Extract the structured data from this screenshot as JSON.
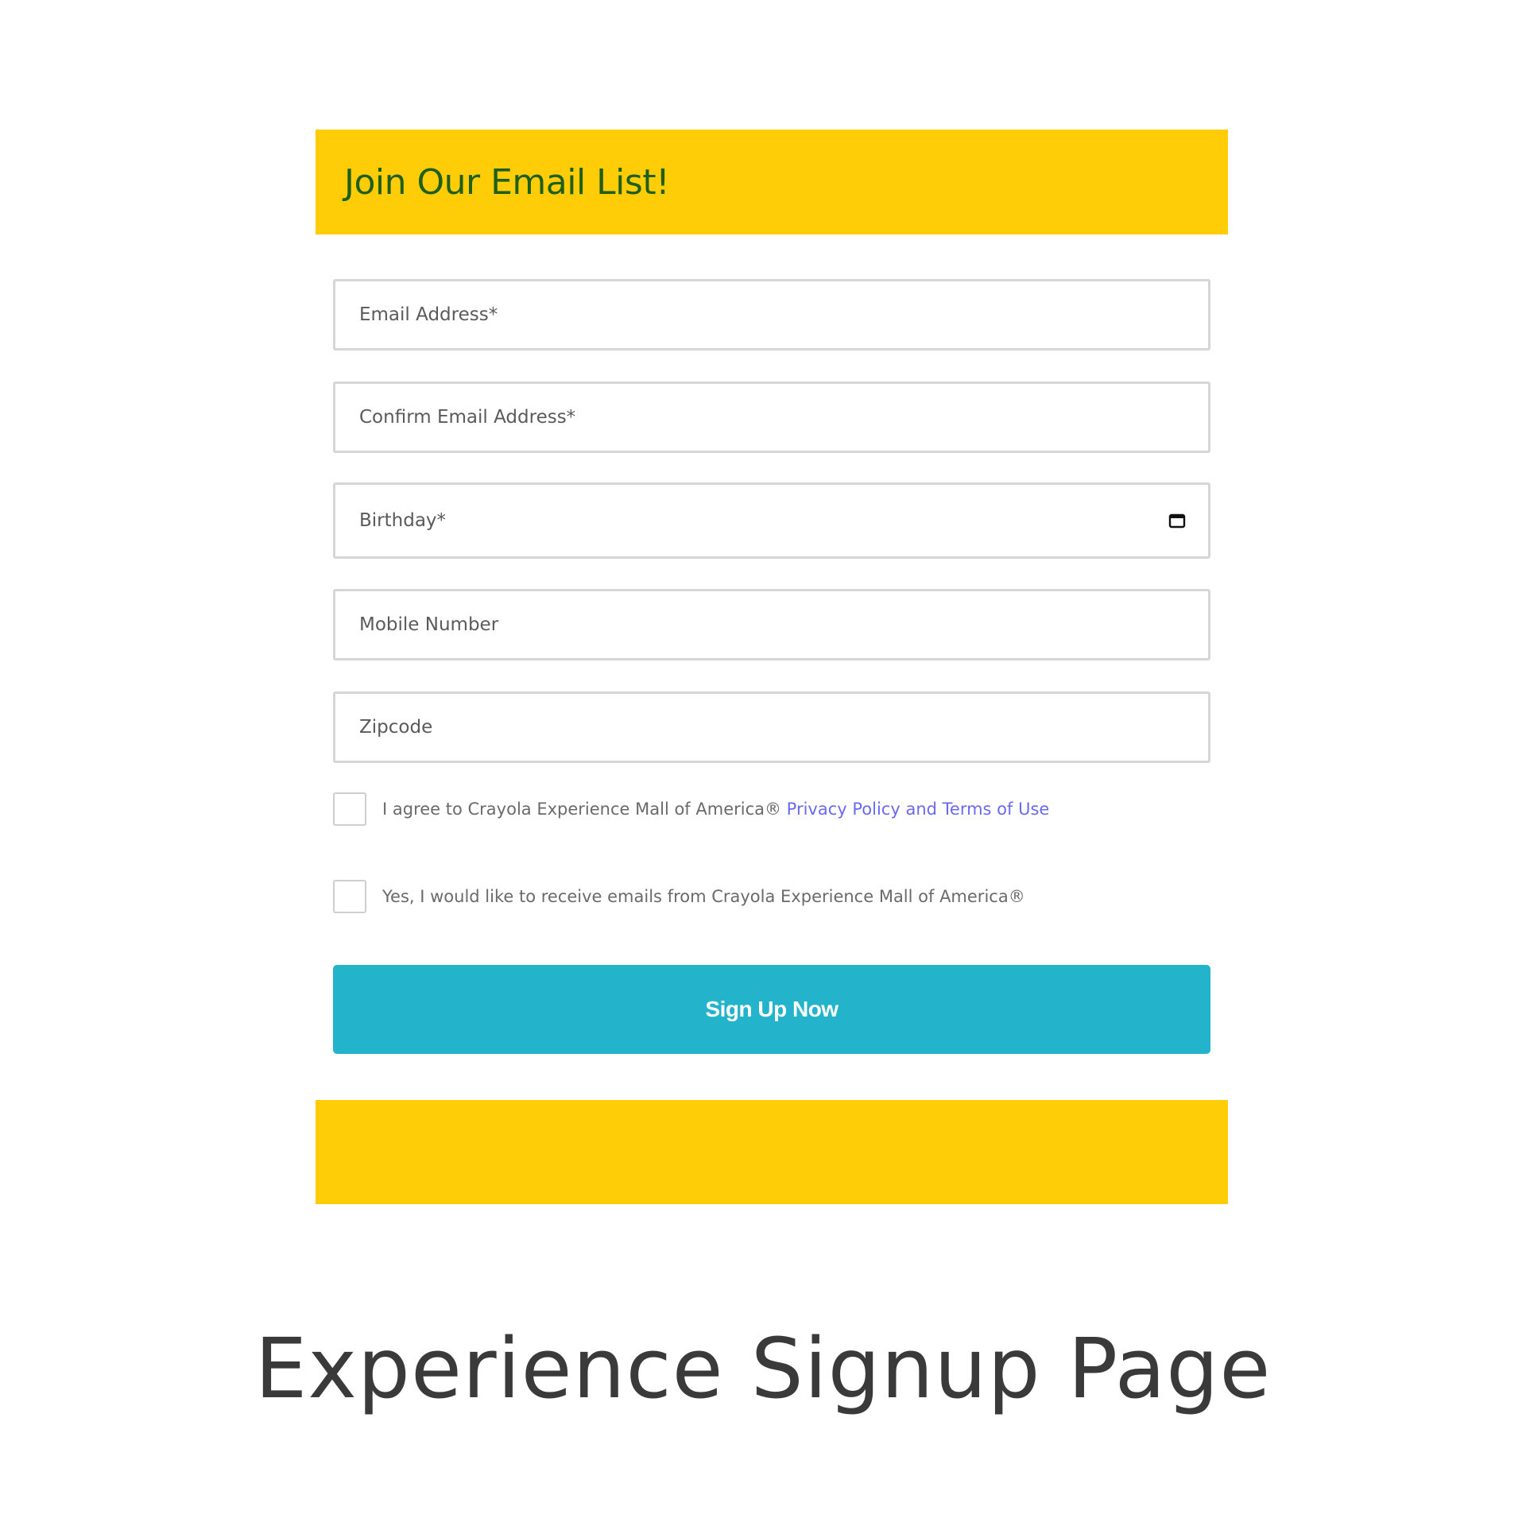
{
  "header": {
    "title": "Join Our Email List!"
  },
  "form": {
    "fields": [
      {
        "placeholder": "Email Address*"
      },
      {
        "placeholder": "Confirm Email Address*"
      },
      {
        "placeholder": "Birthday*",
        "icon": "calendar-icon"
      },
      {
        "placeholder": "Mobile Number"
      },
      {
        "placeholder": "Zipcode"
      }
    ],
    "agree": {
      "label": "I agree to Crayola Experience Mall of America® ",
      "link": "Privacy Policy and Terms of Use",
      "checked": false
    },
    "optin": {
      "label": "Yes, I would like to receive emails from Crayola Experience Mall of America®",
      "checked": false
    },
    "submit_label": "Sign Up Now"
  },
  "caption": "Experience Signup Page",
  "colors": {
    "band": "#FFCC08",
    "title": "#1F5F1A",
    "button": "#23B3CB",
    "link": "#6A6AF0"
  }
}
